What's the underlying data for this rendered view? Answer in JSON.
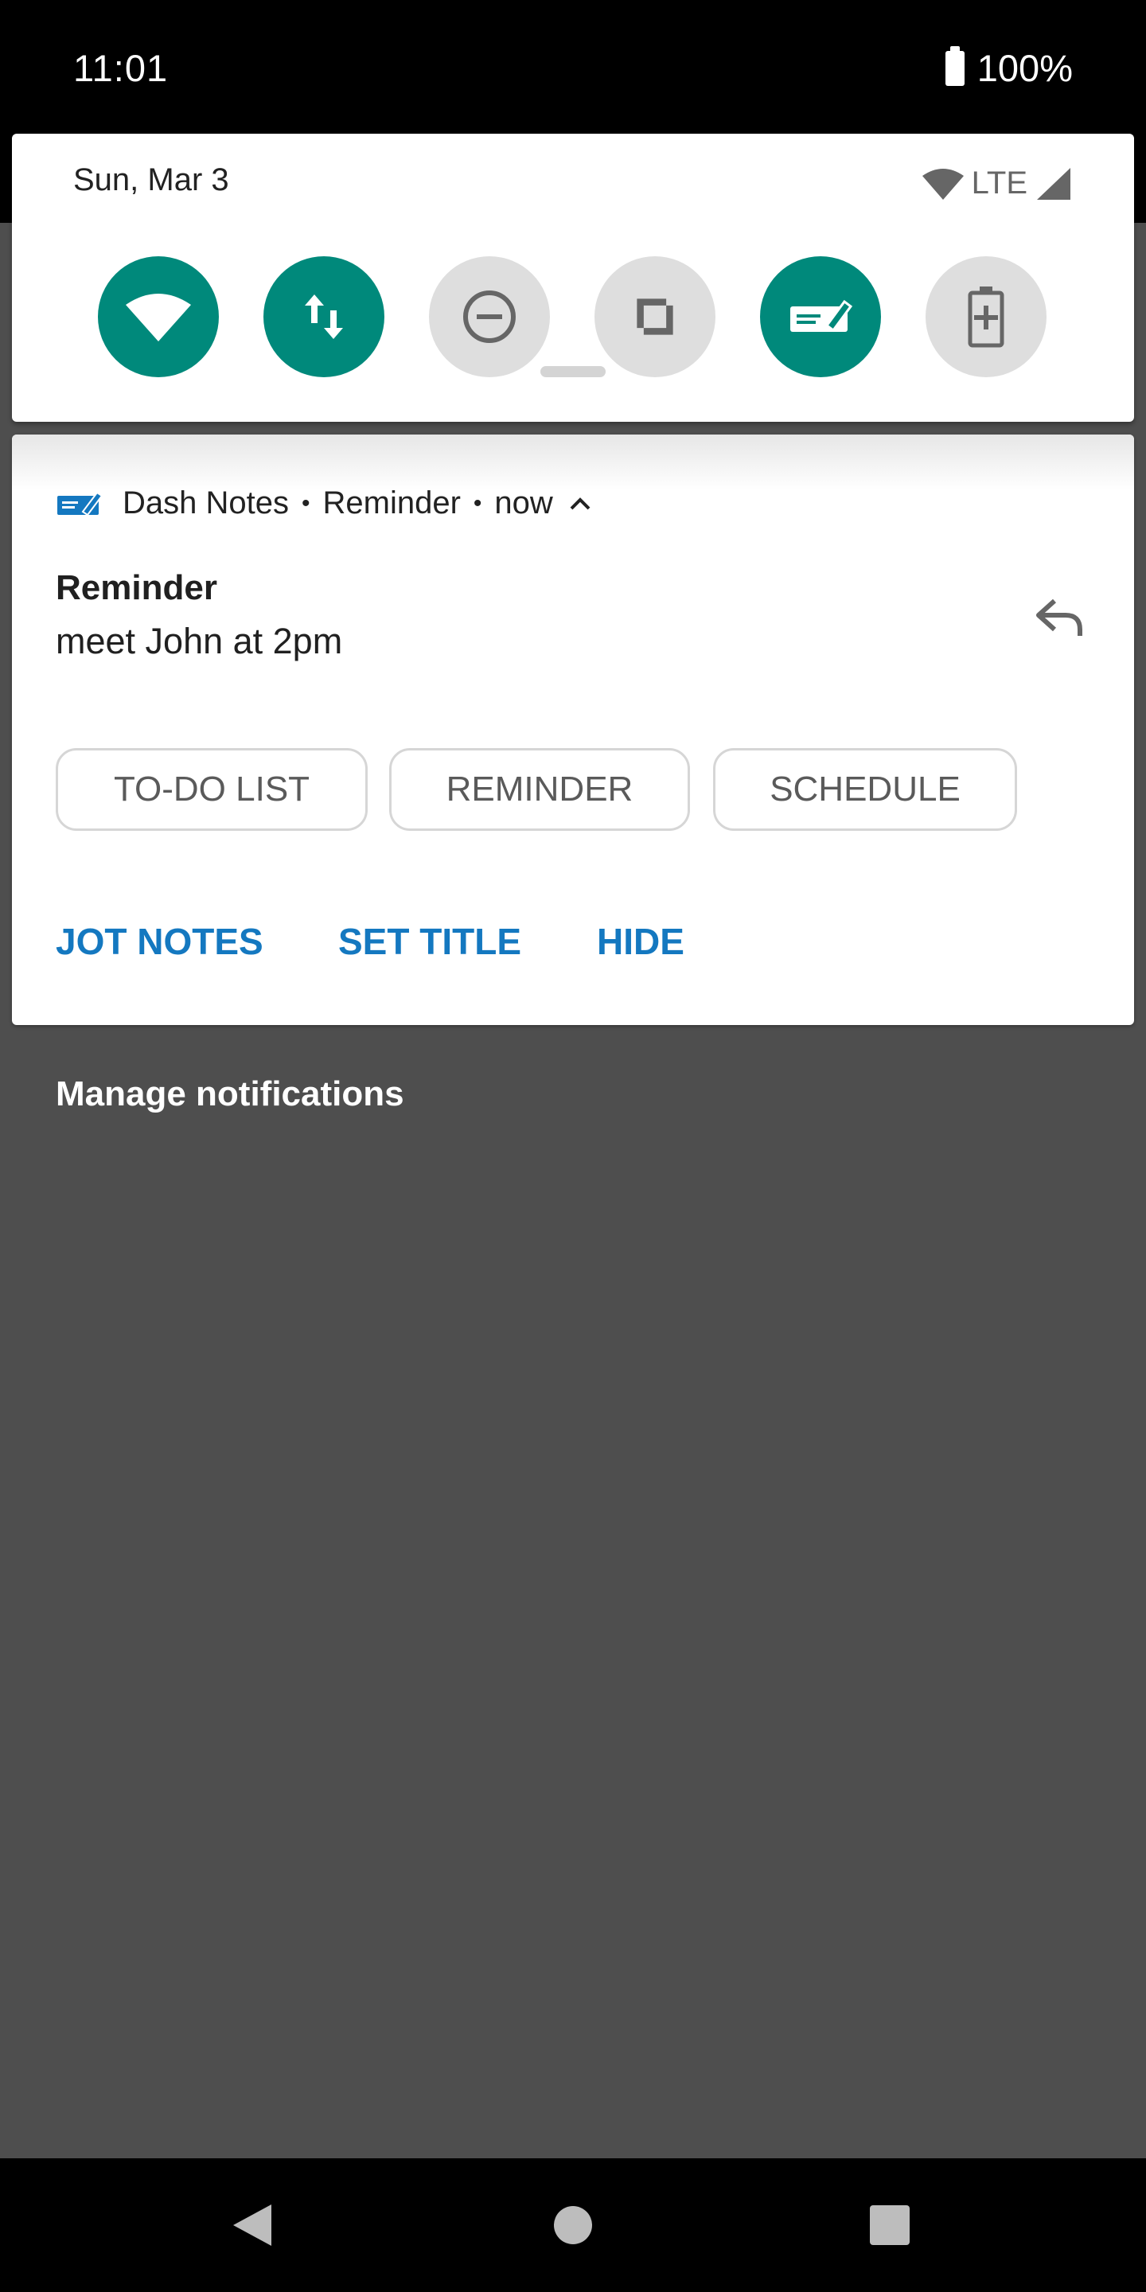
{
  "status_bar": {
    "time": "11:01",
    "battery": "100%"
  },
  "quick_settings": {
    "date": "Sun, Mar 3",
    "network": "LTE",
    "tiles": [
      {
        "name": "wifi",
        "state": "on"
      },
      {
        "name": "mobile-data",
        "state": "on"
      },
      {
        "name": "do-not-disturb",
        "state": "off"
      },
      {
        "name": "auto-rotate",
        "state": "off"
      },
      {
        "name": "dash-notes",
        "state": "on"
      },
      {
        "name": "battery-saver",
        "state": "off"
      }
    ]
  },
  "notification": {
    "app_name": "Dash Notes",
    "channel": "Reminder",
    "time": "now",
    "title": "Reminder",
    "text": "meet John at 2pm",
    "chips": [
      "TO-DO LIST",
      "REMINDER",
      "SCHEDULE"
    ],
    "actions": [
      "JOT NOTES",
      "SET TITLE",
      "HIDE"
    ]
  },
  "manage_label": "Manage notifications",
  "colors": {
    "accent_teal": "#00897b",
    "action_blue": "#1478c0",
    "shade_gray": "#4e4e4e"
  }
}
